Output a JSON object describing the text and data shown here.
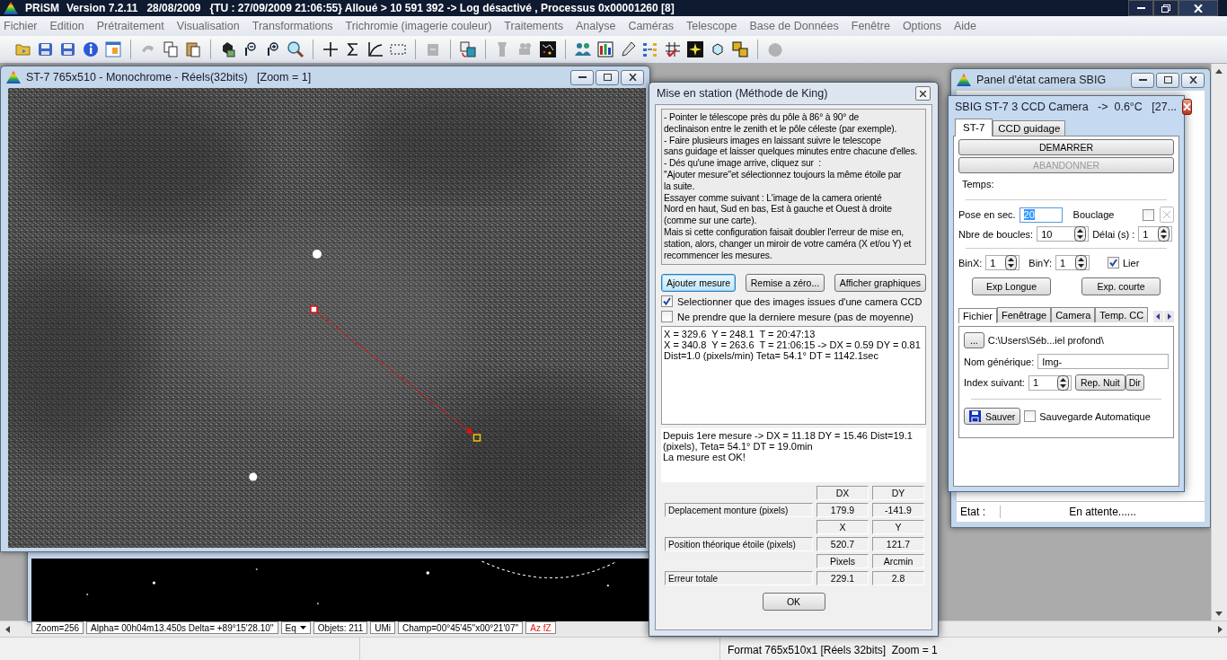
{
  "app": {
    "name": "PRiSM",
    "info": "Version 7.2.11   28/08/2009   {TU : 27/09/2009 21:06:55} Alloué > 10 591 392 -> Log désactivé , Processus 0x00001260 [8]"
  },
  "menu": [
    "Fichier",
    "Edition",
    "Prétraitement",
    "Visualisation",
    "Transformations",
    "Trichromie (imagerie couleur)",
    "Traitements",
    "Analyse",
    "Caméras",
    "Telescope",
    "Base de Données",
    "Fenêtre",
    "Options",
    "Aide"
  ],
  "toolbar": [
    {
      "kind": "folder",
      "disabled": false
    },
    {
      "kind": "disk",
      "disabled": false
    },
    {
      "kind": "disk",
      "disabled": false
    },
    {
      "kind": "info",
      "disabled": false
    },
    {
      "kind": "window",
      "disabled": false
    },
    {
      "kind": "separator"
    },
    {
      "kind": "undo",
      "disabled": true
    },
    {
      "kind": "copy",
      "disabled": false
    },
    {
      "kind": "paste",
      "disabled": false
    },
    {
      "kind": "separator"
    },
    {
      "kind": "lens",
      "disabled": false
    },
    {
      "kind": "zoom-out",
      "disabled": false
    },
    {
      "kind": "zoom-in",
      "disabled": false
    },
    {
      "kind": "magnifier",
      "disabled": false
    },
    {
      "kind": "separator"
    },
    {
      "kind": "cross",
      "disabled": false
    },
    {
      "kind": "sigma",
      "disabled": false
    },
    {
      "kind": "curve",
      "disabled": false
    },
    {
      "kind": "selection",
      "disabled": false
    },
    {
      "kind": "separator"
    },
    {
      "kind": "box",
      "disabled": true
    },
    {
      "kind": "separator"
    },
    {
      "kind": "transfer",
      "disabled": false
    },
    {
      "kind": "separator"
    },
    {
      "kind": "stamp",
      "disabled": true
    },
    {
      "kind": "film",
      "disabled": true
    },
    {
      "kind": "starmap",
      "disabled": false
    },
    {
      "kind": "separator"
    },
    {
      "kind": "people",
      "disabled": false
    },
    {
      "kind": "bars",
      "disabled": false
    },
    {
      "kind": "pen",
      "disabled": false
    },
    {
      "kind": "dots",
      "disabled": false
    },
    {
      "kind": "grid",
      "disabled": false
    },
    {
      "kind": "star",
      "disabled": false
    },
    {
      "kind": "cube",
      "disabled": false
    },
    {
      "kind": "squares",
      "disabled": false
    },
    {
      "kind": "separator"
    },
    {
      "kind": "blob",
      "disabled": true
    }
  ],
  "image_window": {
    "title": "ST-7 765x510 - Monochrome - Réels(32bits)   [Zoom = 1]"
  },
  "map_window": {
    "fields": [
      {
        "kind": "text",
        "text": "Zoom=256"
      },
      {
        "kind": "text",
        "text": "Alpha= 00h04m13.450s Delta= +89°15'28.10''"
      },
      {
        "kind": "dropdown",
        "text": "Eq"
      },
      {
        "kind": "text",
        "text": "Objets: 211"
      },
      {
        "kind": "text",
        "text": "UMi"
      },
      {
        "kind": "text",
        "text": "Champ=00°45'45''x00°21'07''"
      },
      {
        "kind": "alert",
        "text": "Az fZ"
      }
    ]
  },
  "king_dialog": {
    "title": "Mise en station (Méthode de King)",
    "instructions": "- Pointer le télescope près du pôle à 86° à 90° de\ndeclinaison entre le zenith et le pôle céleste (par exemple).\n- Faire plusieurs images en laissant suivre le telescope\nsans guidage et laisser quelques minutes entre chacune d'elles.\n- Dés qu'une image arrive, cliquez sur  :\n''Ajouter mesure''et sélectionnez toujours la même étoile par\nla suite.\nEssayer comme suivant : L'image de la camera orienté\nNord en haut, Sud en bas, Est à gauche et Ouest à droite\n(comme sur une carte).\nMais si cette configuration faisait doubler l'erreur de mise en,\nstation, alors, changer un miroir de votre caméra (X et/ou Y) et\nrecommencer les mesures.",
    "buttons": [
      {
        "label": "Ajouter mesure",
        "selected": true
      },
      {
        "label": "Remise a zéro...",
        "selected": false
      },
      {
        "label": "Afficher graphiques",
        "selected": false
      }
    ],
    "options": [
      {
        "label": "Selectionner que des images issues d'une camera CCD",
        "checked": true
      },
      {
        "label": "Ne prendre que la derniere mesure (pas de moyenne)",
        "checked": false
      }
    ],
    "log": [
      "X = 329.6  Y = 248.1  T = 20:47:13",
      "X = 340.8  Y = 263.6  T = 21:06:15 -> DX = 0.59 DY = 0.81",
      "Dist=1.0 (pixels/min) Teta= 54.1° DT = 1142.1sec"
    ],
    "result": [
      "Depuis 1ere mesure -> DX = 11.18 DY = 15.46 Dist=19.1 (pixels), Teta= 54.1° DT = 19.0min",
      "La mesure est OK!"
    ],
    "table": [
      {
        "headers": [
          "DX",
          "DY"
        ],
        "label": "Deplacement monture (pixels)",
        "values": [
          "179.9",
          "-141.9"
        ]
      },
      {
        "headers": [
          "X",
          "Y"
        ],
        "label": "Position théorique étoile (pixels)",
        "values": [
          "520.7",
          "121.7"
        ]
      },
      {
        "headers": [
          "Pixels",
          "Arcmin"
        ],
        "label": "Erreur totale",
        "values": [
          "229.1",
          "2.8"
        ]
      }
    ],
    "ok": "OK"
  },
  "status_panel": {
    "title": "Panel d'état camera SBIG",
    "state_label": "Etat :",
    "state_value": "En attente......"
  },
  "camera_window": {
    "title": "SBIG ST-7 3 CCD Camera   ->  0.6°C   [27...",
    "tabs": [
      {
        "label": "ST-7",
        "selected": true
      },
      {
        "label": "CCD guidage",
        "selected": false
      }
    ],
    "start_button": {
      "label": "DEMARRER",
      "disabled": false
    },
    "abort_button": {
      "label": "ABANDONNER",
      "disabled": true
    },
    "time_label": "Temps:",
    "exposure": {
      "label": "Pose en sec.",
      "value": "20"
    },
    "loop": {
      "label": "Bouclage",
      "checked": false
    },
    "loop_count": {
      "label": "Nbre de boucles:",
      "value": "10"
    },
    "delay": {
      "label": "Délai (s) :",
      "value": "1"
    },
    "binx": {
      "label": "BinX:",
      "value": "1"
    },
    "biny": {
      "label": "BinY:",
      "value": "1"
    },
    "link": {
      "label": "Lier",
      "checked": true
    },
    "exposure_buttons": [
      "Exp Longue",
      "Exp. courte"
    ],
    "file_tabs": [
      {
        "label": "Fichier",
        "selected": true
      },
      {
        "label": "Fenêtrage",
        "selected": false
      },
      {
        "label": "Camera",
        "selected": false
      },
      {
        "label": "Temp. CC",
        "selected": false
      }
    ],
    "browse_button": "...",
    "path": "C:\\Users\\Séb...iel profond\\",
    "name": {
      "label": "Nom générique:",
      "value": "Img-"
    },
    "index": {
      "label": "Index suivant:",
      "value": "1"
    },
    "night_button": "Rep. Nuit",
    "dir_button": "Dir",
    "save_button": "Sauver",
    "autosave": {
      "label": "Sauvegarde Automatique",
      "checked": false
    }
  },
  "status_bar": {
    "text": "Format 765x510x1 [Réels 32bits]  Zoom = 1"
  }
}
